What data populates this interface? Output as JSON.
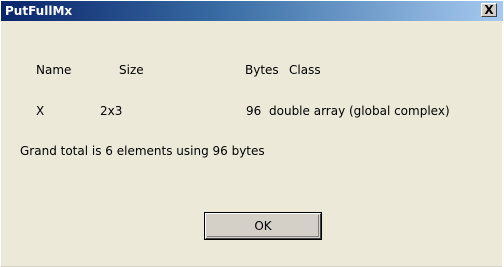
{
  "window": {
    "title": "PutFullMx",
    "close_glyph": "X"
  },
  "table": {
    "headers": {
      "name": "Name",
      "size": "Size",
      "bytes": "Bytes",
      "class": "Class"
    },
    "rows": [
      {
        "name": "X",
        "size": "2x3",
        "bytes": "96",
        "class": "double array (global complex)"
      }
    ]
  },
  "summary": "Grand total is 6 elements using 96 bytes",
  "buttons": {
    "ok_label": "OK"
  },
  "colors": {
    "dialog_bg": "#ece9d8",
    "titlebar_start": "#0a246a",
    "titlebar_end": "#a6caf0"
  }
}
